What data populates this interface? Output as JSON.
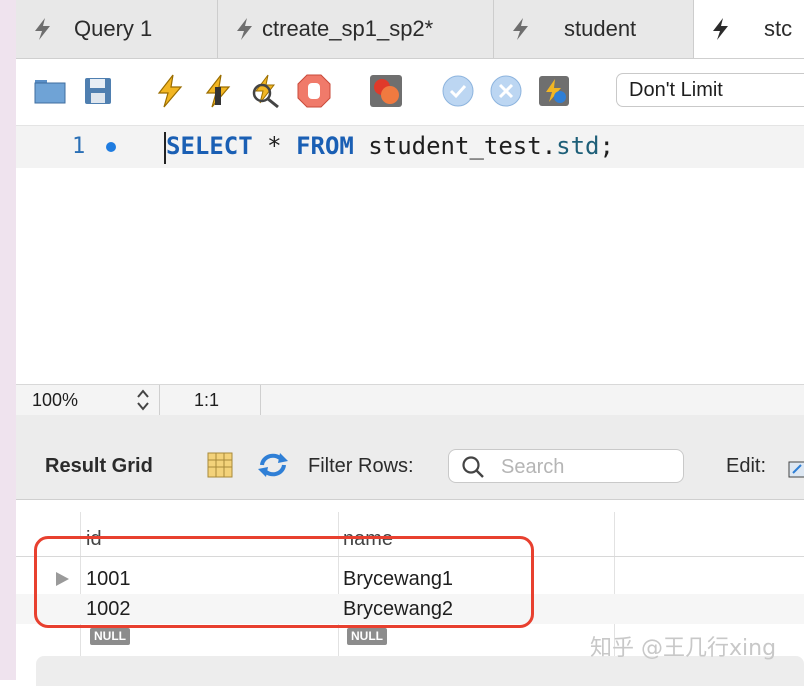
{
  "tabs": [
    {
      "label": "Query 1",
      "icon": "lightning-icon"
    },
    {
      "label": "ctreate_sp1_sp2*",
      "icon": "lightning-icon"
    },
    {
      "label": "student",
      "icon": "lightning-icon"
    },
    {
      "label": "stc",
      "icon": "lightning-icon",
      "active": true
    }
  ],
  "toolbar": {
    "buttons": [
      "open-folder-icon",
      "save-icon",
      "execute-icon",
      "execute-current-icon",
      "explain-icon",
      "stop-icon",
      "toggle-error-icon",
      "commit-icon",
      "rollback-icon",
      "autocommit-icon"
    ],
    "limit_value": "Don't Limit"
  },
  "editor": {
    "line_number": "1",
    "sql": {
      "kw_select": "SELECT",
      "star": " * ",
      "kw_from": "FROM",
      "schema": " student_test.",
      "table": "std",
      "end": ";"
    }
  },
  "status": {
    "zoom": "100%",
    "cursor": "1:1"
  },
  "result": {
    "title": "Result Grid",
    "filter_label": "Filter Rows:",
    "search_placeholder": "Search",
    "edit_label": "Edit:"
  },
  "grid": {
    "columns": [
      "id",
      "name"
    ],
    "rows": [
      {
        "id": "1001",
        "name": "Brycewang1"
      },
      {
        "id": "1002",
        "name": "Brycewang2"
      }
    ],
    "null_label": "NULL"
  },
  "watermark": "知乎 @王几行xing",
  "colors": {
    "accent": "#1a5fb4",
    "highlight": "#e8402f"
  }
}
